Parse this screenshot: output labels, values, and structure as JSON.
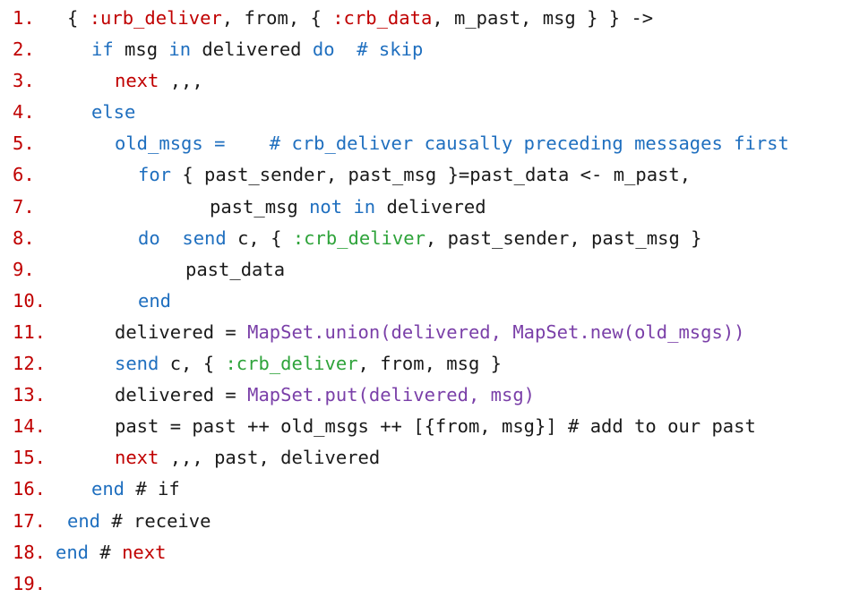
{
  "colors": {
    "line_number": "#c00000",
    "keyword": "#1f6fbf",
    "atom": "#c00000",
    "send_atom": "#2ea33a",
    "module_call": "#7a3fa8",
    "plain": "#1a1a1a"
  },
  "lines": [
    {
      "num": "1.",
      "indent": 75,
      "tokens": [
        {
          "t": "{ ",
          "c": "plain"
        },
        {
          "t": ":urb_deliver",
          "c": "red"
        },
        {
          "t": ", from, { ",
          "c": "plain"
        },
        {
          "t": ":crb_data",
          "c": "red"
        },
        {
          "t": ", m_past, msg } } ->",
          "c": "plain"
        }
      ]
    },
    {
      "num": "2.",
      "indent": 102,
      "tokens": [
        {
          "t": "if",
          "c": "blue"
        },
        {
          "t": " msg ",
          "c": "plain"
        },
        {
          "t": "in",
          "c": "blue"
        },
        {
          "t": " delivered ",
          "c": "plain"
        },
        {
          "t": "do",
          "c": "blue"
        },
        {
          "t": "  # skip",
          "c": "blue"
        }
      ]
    },
    {
      "num": "3.",
      "indent": 128,
      "tokens": [
        {
          "t": "next",
          "c": "red"
        },
        {
          "t": " ,,,",
          "c": "plain"
        }
      ]
    },
    {
      "num": "4.",
      "indent": 102,
      "tokens": [
        {
          "t": "else",
          "c": "blue"
        }
      ]
    },
    {
      "num": "5.",
      "indent": 128,
      "tokens": [
        {
          "t": "old_msgs =    # crb_deliver causally preceding messages first",
          "c": "blue"
        }
      ]
    },
    {
      "num": "6.",
      "indent": 154,
      "tokens": [
        {
          "t": "for",
          "c": "blue"
        },
        {
          "t": " { past_sender, past_msg }=past_data <- m_past,",
          "c": "plain"
        }
      ]
    },
    {
      "num": "7.",
      "indent": 234,
      "tokens": [
        {
          "t": "past_msg ",
          "c": "plain"
        },
        {
          "t": "not",
          "c": "blue"
        },
        {
          "t": " ",
          "c": "plain"
        },
        {
          "t": "in",
          "c": "blue"
        },
        {
          "t": " delivered",
          "c": "plain"
        }
      ]
    },
    {
      "num": "8.",
      "indent": 154,
      "tokens": [
        {
          "t": "do",
          "c": "blue"
        },
        {
          "t": "  ",
          "c": "plain"
        },
        {
          "t": "send",
          "c": "blue"
        },
        {
          "t": " c, { ",
          "c": "plain"
        },
        {
          "t": ":crb_deliver",
          "c": "green"
        },
        {
          "t": ", past_sender, past_msg }",
          "c": "plain"
        }
      ]
    },
    {
      "num": "9.",
      "indent": 207,
      "tokens": [
        {
          "t": "past_data",
          "c": "plain"
        }
      ]
    },
    {
      "num": "10.",
      "indent": 154,
      "tokens": [
        {
          "t": "end",
          "c": "blue"
        }
      ]
    },
    {
      "num": "11.",
      "indent": 128,
      "tokens": [
        {
          "t": "delivered = ",
          "c": "plain"
        },
        {
          "t": "MapSet.union(delivered, MapSet.new(old_msgs))",
          "c": "purple"
        }
      ]
    },
    {
      "num": "12.",
      "indent": 128,
      "tokens": [
        {
          "t": "send",
          "c": "blue"
        },
        {
          "t": " c, { ",
          "c": "plain"
        },
        {
          "t": ":crb_deliver",
          "c": "green"
        },
        {
          "t": ", from, msg }",
          "c": "plain"
        }
      ]
    },
    {
      "num": "13.",
      "indent": 128,
      "tokens": [
        {
          "t": "delivered = ",
          "c": "plain"
        },
        {
          "t": "MapSet.put(delivered, msg)",
          "c": "purple"
        }
      ]
    },
    {
      "num": "14.",
      "indent": 128,
      "tokens": [
        {
          "t": "past = past ++ old_msgs ++ [{from, msg}] # add to our past",
          "c": "plain"
        }
      ]
    },
    {
      "num": "15.",
      "indent": 128,
      "tokens": [
        {
          "t": "next",
          "c": "red"
        },
        {
          "t": " ,,, past, delivered",
          "c": "plain"
        }
      ]
    },
    {
      "num": "16.",
      "indent": 102,
      "tokens": [
        {
          "t": "end",
          "c": "blue"
        },
        {
          "t": " # if",
          "c": "plain"
        }
      ]
    },
    {
      "num": "17.",
      "indent": 75,
      "tokens": [
        {
          "t": "end",
          "c": "blue"
        },
        {
          "t": " # receive",
          "c": "plain"
        }
      ]
    },
    {
      "num": "18.",
      "indent": 62,
      "tokens": [
        {
          "t": "end",
          "c": "blue"
        },
        {
          "t": " # ",
          "c": "plain"
        },
        {
          "t": "next",
          "c": "red"
        }
      ]
    },
    {
      "num": "19.",
      "indent": 62,
      "tokens": []
    }
  ]
}
